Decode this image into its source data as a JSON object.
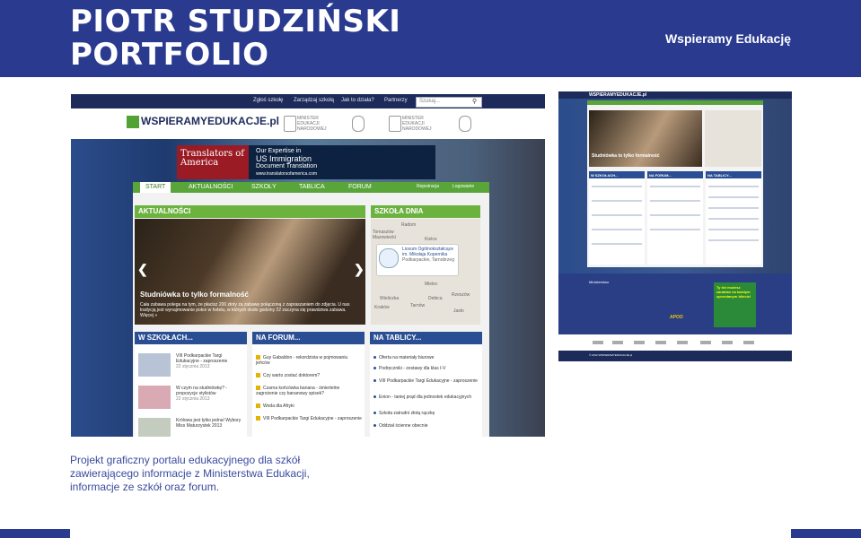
{
  "header": {
    "title_line1": "PIOTR STUDZIŃSKI",
    "title_line2": "PORTFOLIO",
    "brand": "Wspieramy Edukację",
    "color": "#2a3a8f"
  },
  "caption": "Projekt graficzny portalu edukacyjnego dla szkół zawierającego informacje z Ministerstwa Edukacji, informacje ze szkół oraz forum.",
  "site": {
    "toplinks": [
      "Zgłoś szkołę",
      "Zarządzaj szkołą",
      "Jak to działa?",
      "Partnerzy"
    ],
    "search_placeholder": "Szukaj...",
    "logo": "WSPIERAMYEDUKACJE.pl",
    "ministry_labels": [
      "MINISTER EDUKACJI NARODOWEJ",
      "MINISTER EDUKACJI NARODOWEJ"
    ],
    "ad": {
      "brand": "Translators of America",
      "line1": "Our Expertise in",
      "line2": "US Immigration",
      "line3": "Document Translation",
      "url": "www.translatorsofamerica.com"
    },
    "nav": [
      "START",
      "AKTUALNOŚCI",
      "SZKOŁY",
      "TABLICA",
      "FORUM"
    ],
    "nav_right": [
      "Rejestracja",
      "Logowanie"
    ],
    "news": {
      "heading": "AKTUALNOŚCI",
      "title": "Studniówka to tylko formalność",
      "text": "Cała zabawa polega na tym, że płacisz 200 złoty za zabawę połączoną z zapraszaniem do zdjęcia. U nas tradycją jest wynajmowanie pokoi w hotelu, w których około godziny 22 zaczyna się prawdziwa zabawa. Więcej »"
    },
    "school_of_day": {
      "heading": "SZKOŁA DNIA",
      "name": "Liceum Ogólnokształcące im. Mikołaja Kopernika",
      "place": "Podkarpackie, Tarnobrzeg",
      "cities": [
        "Radom",
        "Tomaszów Mazowiecki",
        "Kielce",
        "Kraków",
        "Tarnów",
        "Debica",
        "Rzeszów",
        "Jasło",
        "Wieliczka",
        "Mielec"
      ]
    },
    "schools": {
      "heading": "W SZKOŁACH...",
      "items": [
        {
          "title": "VIII Podkarpackie Targi Edukacyjne - zaproszenie",
          "date": "22 stycznia 2013"
        },
        {
          "title": "W czym na studniówkę? - propozycje stylistów",
          "date": "22 stycznia 2013"
        },
        {
          "title": "Królowa jest tylko jedna! Wybory Miss Maturzystek 2013",
          "date": ""
        }
      ]
    },
    "forum": {
      "heading": "NA FORUM...",
      "items": [
        "Guy Gabaldon - rekordzista w pojmowaniu jeńców",
        "Czy warto zostać doktorem?",
        "Czarna końcówka banana - śmiertelne zagrożenie czy bananowy spisek?",
        "Woda dla Afryki",
        "VIII Podkarpackie Targi Edukacyjne - zaproszenie"
      ]
    },
    "board": {
      "heading": "NA TABLICY...",
      "items": [
        "Oferta na materiały biurowe",
        "Podręczniki - zestawy dla klas I-V",
        "VIII Podkarpackie Targi Edukacyjne - zaproszenie",
        "Enion - taniej prąd dla jednostek edukacyjnych",
        "Szkoła zatrudni złotą rączkę",
        "Oddział ścienne obecnie"
      ]
    }
  },
  "site_full": {
    "logo": "WSPIERAMYEDUKACJE.pl",
    "slide_title": "Studniówka to tylko formalność",
    "columns": [
      "W SZKOŁACH...",
      "NA FORUM...",
      "NA TABLICY..."
    ],
    "footer_heading": "Ministerstwo",
    "ad_text": "Ty też możesz zarabiać na każdym sprzedanym bilecie!",
    "apoo": "APOO",
    "bottom": "© 2013 WSPIERAMYEDUKACJE.pl"
  }
}
